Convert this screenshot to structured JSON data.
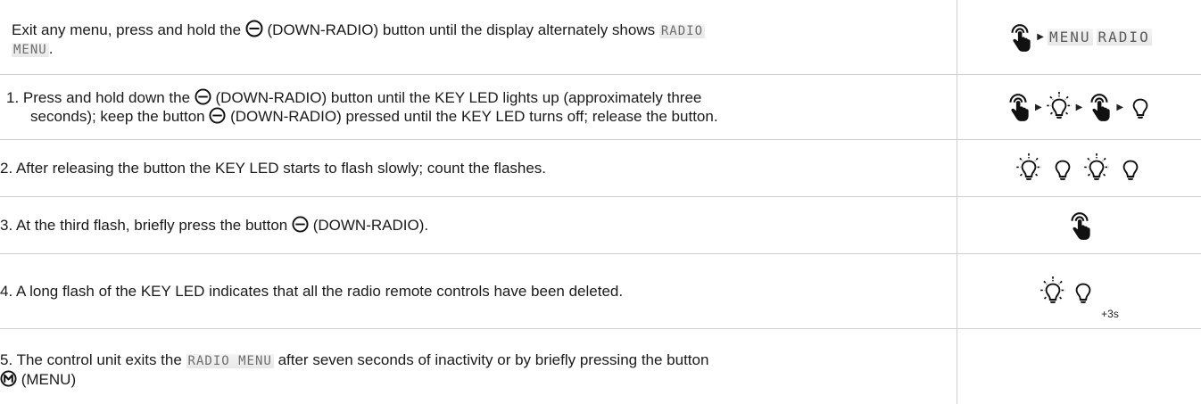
{
  "rows": [
    {
      "pre": "Exit any menu, press and hold the",
      "post": "(DOWN-RADIO) button until the display alternately shows",
      "lcd": "RADIO",
      "tail_lcd": "MENU",
      "tail": ".",
      "icon_lcd_1": "MENU",
      "icon_lcd_2": "RADIO"
    },
    {
      "pre": "1. Press and hold down the",
      "mid": "(DOWN-RADIO) button until the KEY LED lights up (approximately three",
      "line2_pre": "seconds); keep the button",
      "line2_post": "(DOWN-RADIO) pressed until the KEY LED turns off; release the button."
    },
    {
      "text": "2. After releasing the button the KEY LED starts to flash slowly; count the flashes."
    },
    {
      "pre": "3. At the third flash, briefly press the button",
      "post": "(DOWN-RADIO)."
    },
    {
      "text": "4. A long flash of the KEY LED indicates that all the radio remote controls have been deleted.",
      "sub": "+3s"
    },
    {
      "pre": "5. The control unit exits the",
      "lcd": "RADIO MENU",
      "post": "after seven seconds of inactivity or by briefly pressing the button",
      "line2": "(MENU)"
    }
  ]
}
